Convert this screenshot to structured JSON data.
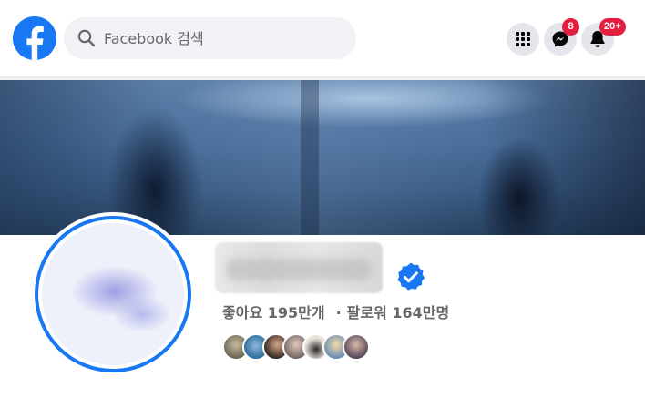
{
  "header": {
    "search_placeholder": "Facebook 검색",
    "messenger_badge": "8",
    "notifications_badge": "20+"
  },
  "profile": {
    "likes": "좋아요 195만개",
    "separator": "·",
    "followers": "팔로워 164만명"
  },
  "colors": {
    "brand": "#1877f2",
    "badge": "#e41e3f",
    "search_bg": "#f0f2f5",
    "button_bg": "#e4e6eb",
    "secondary_text": "#65676b"
  },
  "icons": [
    "facebook-logo",
    "search-icon",
    "apps-grid-icon",
    "messenger-icon",
    "bell-icon",
    "verified-badge-icon"
  ]
}
